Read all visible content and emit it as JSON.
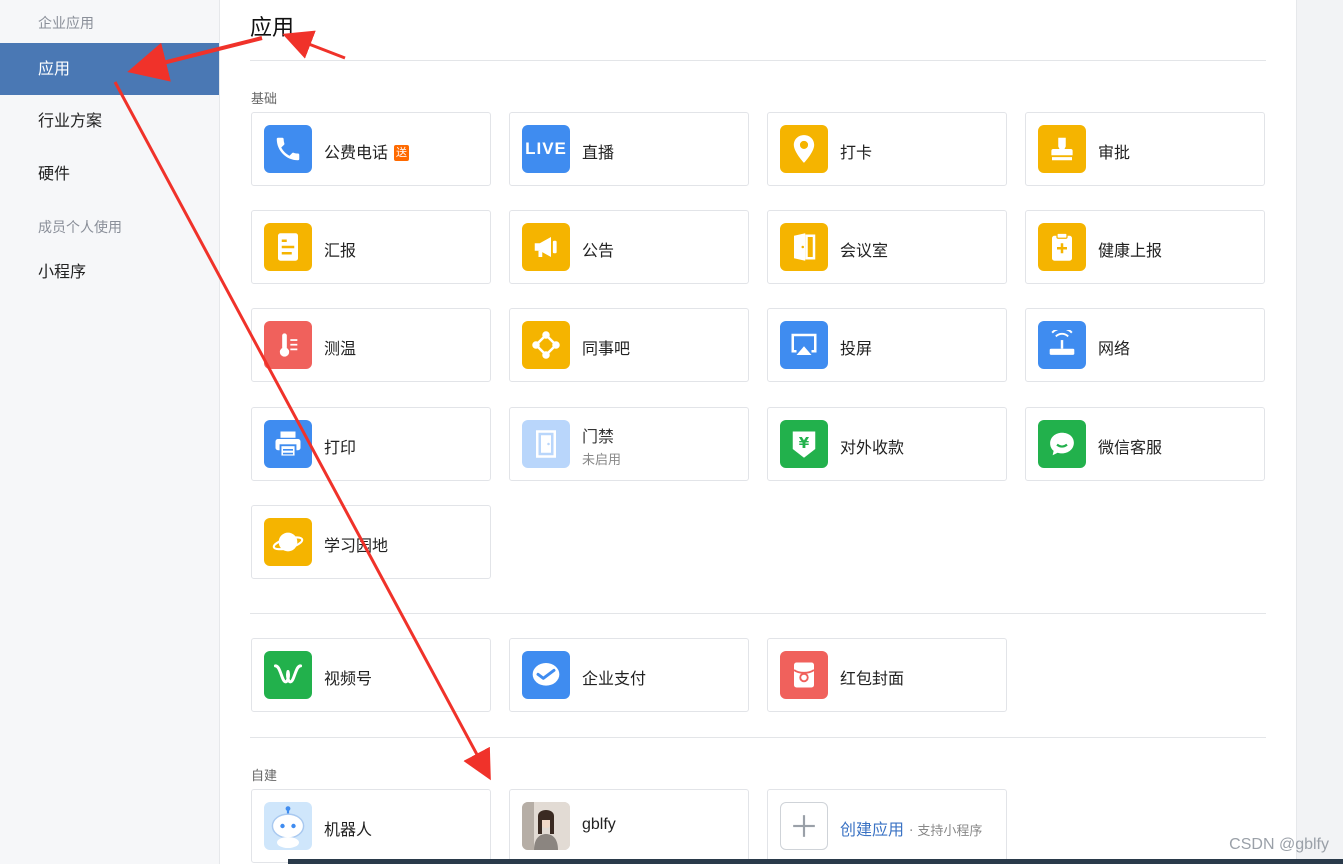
{
  "sidebar": {
    "group1": "企业应用",
    "items": [
      "应用",
      "行业方案",
      "硬件"
    ],
    "group2": "成员个人使用",
    "items2": [
      "小程序"
    ]
  },
  "page": {
    "title": "应用"
  },
  "sections": {
    "basic": "基础",
    "custom": "自建"
  },
  "apps": {
    "phone": "公费电话",
    "phone_badge": "送",
    "live": "直播",
    "live_icon_text": "LIVE",
    "checkin": "打卡",
    "approval": "审批",
    "report": "汇报",
    "notice": "公告",
    "meeting": "会议室",
    "health": "健康上报",
    "temp": "测温",
    "colleague": "同事吧",
    "screen": "投屏",
    "network": "网络",
    "print": "打印",
    "door": "门禁",
    "door_status": "未启用",
    "payment": "对外收款",
    "wechat_service": "微信客服",
    "study": "学习园地",
    "channels": "视频号",
    "corp_pay": "企业支付",
    "red_packet": "红包封面",
    "robot": "机器人",
    "gblfy": "gblfy",
    "create": "创建应用",
    "create_hint": "· 支持小程序"
  },
  "colors": {
    "active_nav": "#4a78b4",
    "blue": "#3f8cf0",
    "yellow": "#f5b400",
    "red": "#f0615c",
    "green": "#22b14c",
    "arrow": "#f0322a"
  },
  "watermark": "CSDN @gblfy"
}
